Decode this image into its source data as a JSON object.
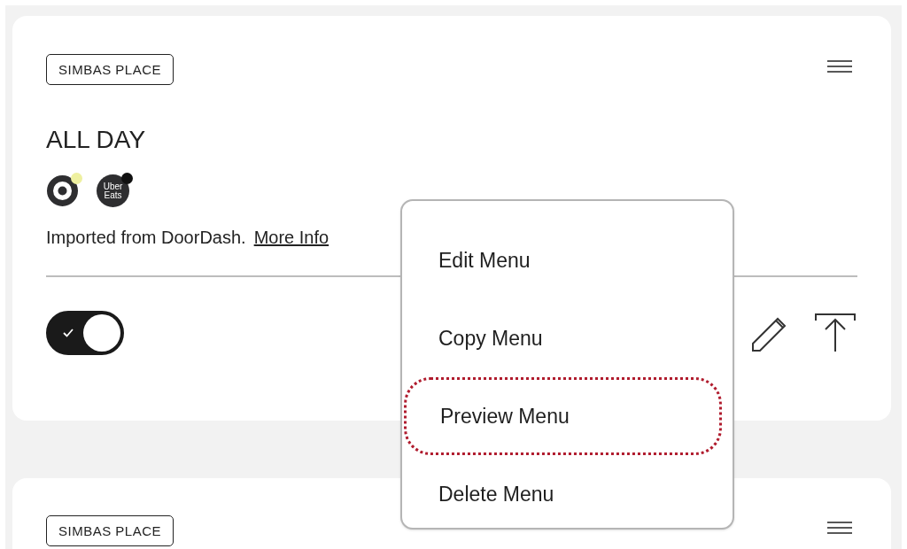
{
  "cards": [
    {
      "tag": "SIMBAS PLACE",
      "title": "ALL DAY",
      "platforms": [
        {
          "kind": "target",
          "color": "#eef0a0"
        },
        {
          "kind": "uber",
          "lines": [
            "Uber",
            "Eats"
          ],
          "color": "#111111"
        }
      ],
      "note": "Imported from DoorDash.",
      "link": "More Info",
      "toggle": {
        "on": true
      }
    },
    {
      "tag": "SIMBAS PLACE"
    }
  ],
  "context_menu": {
    "items": [
      {
        "label": "Edit Menu",
        "highlighted": false
      },
      {
        "label": "Copy Menu",
        "highlighted": false
      },
      {
        "label": "Preview Menu",
        "highlighted": true
      },
      {
        "label": "Delete Menu",
        "highlighted": false
      }
    ]
  }
}
